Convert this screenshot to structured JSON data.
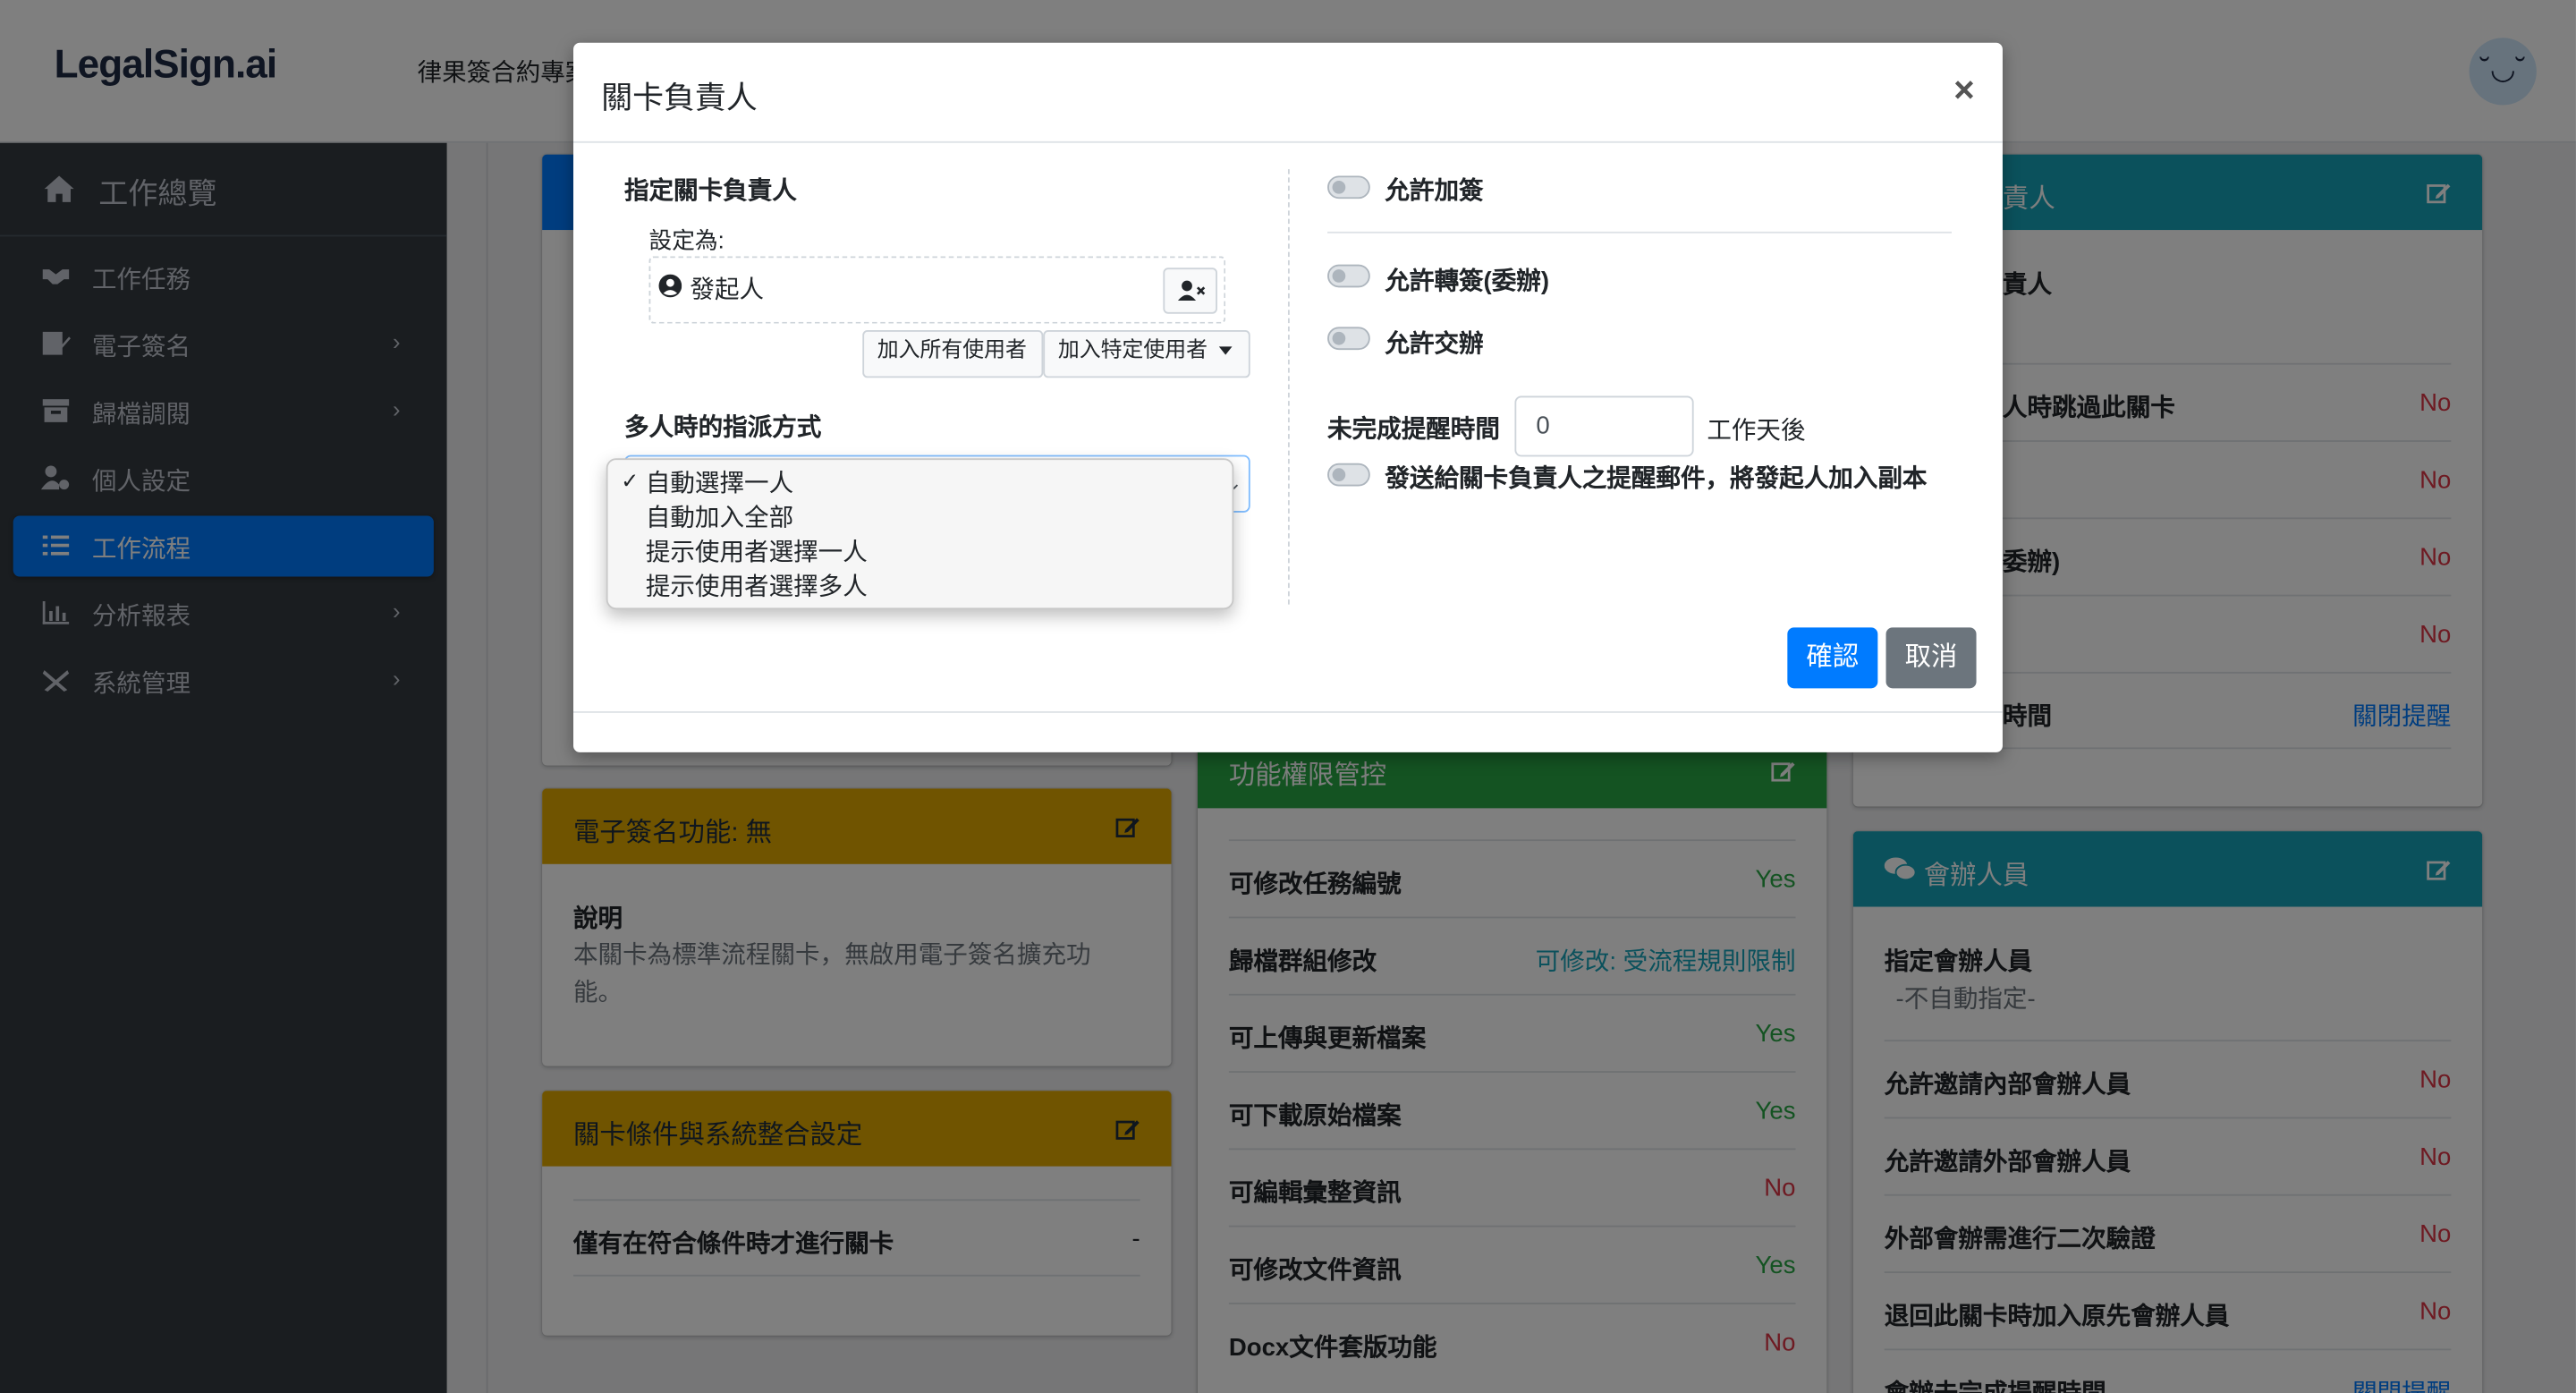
{
  "app": {
    "logo": "LegalSign.ai",
    "title": "律果簽合約專案"
  },
  "colors": {
    "primary": "#007bff",
    "sidebar_bg": "#343a40",
    "yellow_header": "#e0a800",
    "green_header": "#28a745",
    "teal_header": "#17a2b8",
    "yes": "#28a745",
    "no": "#dc3545"
  },
  "sidebar": {
    "header": {
      "label": "工作總覽",
      "icon": "home-icon"
    },
    "items": [
      {
        "label": "工作任務",
        "icon": "handshake-icon",
        "has_submenu": false
      },
      {
        "label": "電子簽名",
        "icon": "signature-icon",
        "has_submenu": true
      },
      {
        "label": "歸檔調閱",
        "icon": "archive-icon",
        "has_submenu": true
      },
      {
        "label": "個人設定",
        "icon": "user-cog-icon",
        "has_submenu": false
      },
      {
        "label": "工作流程",
        "icon": "tasks-icon",
        "has_submenu": false,
        "active": true
      },
      {
        "label": "分析報表",
        "icon": "chart-bar-icon",
        "has_submenu": true
      },
      {
        "label": "系統管理",
        "icon": "tools-icon",
        "has_submenu": true
      }
    ]
  },
  "cards": {
    "esign": {
      "title": "電子簽名功能: 無",
      "desc_label": "說明",
      "desc_text": "本關卡為標準流程關卡，無啟用電子簽名擴充功能。"
    },
    "conditions": {
      "title": "關卡條件與系統整合設定",
      "rows": [
        {
          "label": "僅有在符合條件時才進行關卡",
          "value": "-"
        }
      ]
    },
    "permissions": {
      "title": "功能權限管控",
      "rows": [
        {
          "label": "可修改任務編號",
          "value": "Yes"
        },
        {
          "label": "歸檔群組修改",
          "value": "可修改: 受流程規則限制"
        },
        {
          "label": "可上傳與更新檔案",
          "value": "Yes"
        },
        {
          "label": "可下載原始檔案",
          "value": "Yes"
        },
        {
          "label": "可編輯彙整資訊",
          "value": "No"
        },
        {
          "label": "可修改文件資訊",
          "value": "Yes"
        },
        {
          "label": "Docx文件套版功能",
          "value": "No"
        }
      ]
    },
    "owner": {
      "title_visible": "責人",
      "sub_visible": "責人",
      "rows": [
        {
          "label": "人時跳過此關卡",
          "value": "No"
        },
        {
          "label": "",
          "value": "No"
        },
        {
          "label": "委辦)",
          "value": "No"
        },
        {
          "label": "",
          "value": "No"
        },
        {
          "label": "時間",
          "value": "關閉提醒"
        }
      ]
    },
    "cosign": {
      "title": "會辦人員",
      "assign_label": "指定會辦人員",
      "assign_value": "-不自動指定-",
      "rows": [
        {
          "label": "允許邀請內部會辦人員",
          "value": "No"
        },
        {
          "label": "允許邀請外部會辦人員",
          "value": "No"
        },
        {
          "label": "外部會辦需進行二次驗證",
          "value": "No"
        },
        {
          "label": "退回此關卡時加入原先會辦人員",
          "value": "No"
        },
        {
          "label": "會辦未完成提醒時間",
          "value": "關閉提醒"
        }
      ]
    }
  },
  "modal": {
    "title": "關卡負責人",
    "close": "×",
    "assign_heading": "指定關卡負責人",
    "set_as_label": "設定為:",
    "assignee": "發起人",
    "add_all_users": "加入所有使用者",
    "add_specific_user": "加入特定使用者",
    "multi_heading": "多人時的指派方式",
    "select_options": [
      "自動選擇一人",
      "自動加入全部",
      "提示使用者選擇一人",
      "提示使用者選擇多人"
    ],
    "selected_option": "自動選擇一人",
    "check_mark": "✓",
    "toggles": {
      "allow_add_sign": {
        "label": "允許加簽",
        "on": false
      },
      "allow_transfer": {
        "label": "允許轉簽(委辦)",
        "on": false
      },
      "allow_handover": {
        "label": "允許交辦",
        "on": false
      },
      "cc_initiator": {
        "label": "發送給關卡負責人之提醒郵件，將發起人加入副本",
        "on": false
      }
    },
    "reminder_label": "未完成提醒時間",
    "reminder_value": "0",
    "reminder_unit": "工作天後",
    "confirm": "確認",
    "cancel": "取消"
  }
}
